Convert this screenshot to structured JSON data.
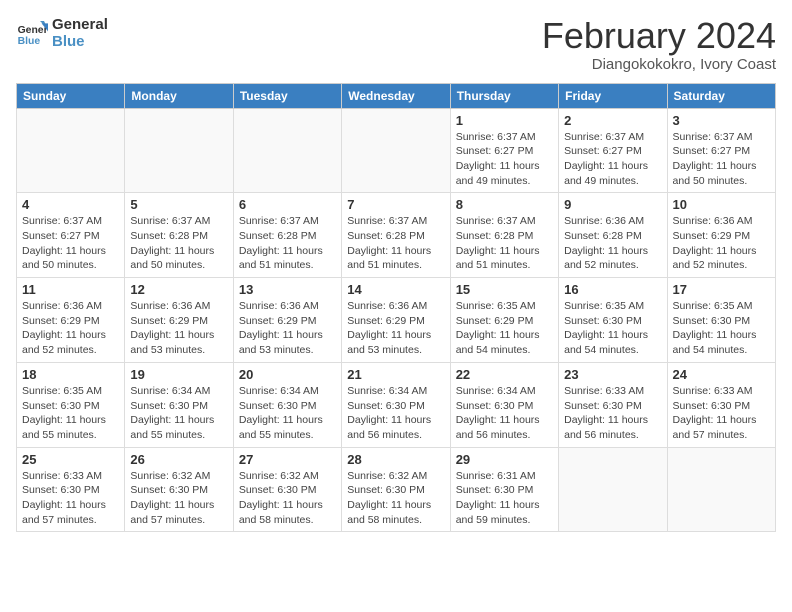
{
  "logo": {
    "line1": "General",
    "line2": "Blue"
  },
  "title": "February 2024",
  "subtitle": "Diangokokokro, Ivory Coast",
  "headers": [
    "Sunday",
    "Monday",
    "Tuesday",
    "Wednesday",
    "Thursday",
    "Friday",
    "Saturday"
  ],
  "weeks": [
    [
      {
        "day": "",
        "info": ""
      },
      {
        "day": "",
        "info": ""
      },
      {
        "day": "",
        "info": ""
      },
      {
        "day": "",
        "info": ""
      },
      {
        "day": "1",
        "info": "Sunrise: 6:37 AM\nSunset: 6:27 PM\nDaylight: 11 hours\nand 49 minutes."
      },
      {
        "day": "2",
        "info": "Sunrise: 6:37 AM\nSunset: 6:27 PM\nDaylight: 11 hours\nand 49 minutes."
      },
      {
        "day": "3",
        "info": "Sunrise: 6:37 AM\nSunset: 6:27 PM\nDaylight: 11 hours\nand 50 minutes."
      }
    ],
    [
      {
        "day": "4",
        "info": "Sunrise: 6:37 AM\nSunset: 6:27 PM\nDaylight: 11 hours\nand 50 minutes."
      },
      {
        "day": "5",
        "info": "Sunrise: 6:37 AM\nSunset: 6:28 PM\nDaylight: 11 hours\nand 50 minutes."
      },
      {
        "day": "6",
        "info": "Sunrise: 6:37 AM\nSunset: 6:28 PM\nDaylight: 11 hours\nand 51 minutes."
      },
      {
        "day": "7",
        "info": "Sunrise: 6:37 AM\nSunset: 6:28 PM\nDaylight: 11 hours\nand 51 minutes."
      },
      {
        "day": "8",
        "info": "Sunrise: 6:37 AM\nSunset: 6:28 PM\nDaylight: 11 hours\nand 51 minutes."
      },
      {
        "day": "9",
        "info": "Sunrise: 6:36 AM\nSunset: 6:28 PM\nDaylight: 11 hours\nand 52 minutes."
      },
      {
        "day": "10",
        "info": "Sunrise: 6:36 AM\nSunset: 6:29 PM\nDaylight: 11 hours\nand 52 minutes."
      }
    ],
    [
      {
        "day": "11",
        "info": "Sunrise: 6:36 AM\nSunset: 6:29 PM\nDaylight: 11 hours\nand 52 minutes."
      },
      {
        "day": "12",
        "info": "Sunrise: 6:36 AM\nSunset: 6:29 PM\nDaylight: 11 hours\nand 53 minutes."
      },
      {
        "day": "13",
        "info": "Sunrise: 6:36 AM\nSunset: 6:29 PM\nDaylight: 11 hours\nand 53 minutes."
      },
      {
        "day": "14",
        "info": "Sunrise: 6:36 AM\nSunset: 6:29 PM\nDaylight: 11 hours\nand 53 minutes."
      },
      {
        "day": "15",
        "info": "Sunrise: 6:35 AM\nSunset: 6:29 PM\nDaylight: 11 hours\nand 54 minutes."
      },
      {
        "day": "16",
        "info": "Sunrise: 6:35 AM\nSunset: 6:30 PM\nDaylight: 11 hours\nand 54 minutes."
      },
      {
        "day": "17",
        "info": "Sunrise: 6:35 AM\nSunset: 6:30 PM\nDaylight: 11 hours\nand 54 minutes."
      }
    ],
    [
      {
        "day": "18",
        "info": "Sunrise: 6:35 AM\nSunset: 6:30 PM\nDaylight: 11 hours\nand 55 minutes."
      },
      {
        "day": "19",
        "info": "Sunrise: 6:34 AM\nSunset: 6:30 PM\nDaylight: 11 hours\nand 55 minutes."
      },
      {
        "day": "20",
        "info": "Sunrise: 6:34 AM\nSunset: 6:30 PM\nDaylight: 11 hours\nand 55 minutes."
      },
      {
        "day": "21",
        "info": "Sunrise: 6:34 AM\nSunset: 6:30 PM\nDaylight: 11 hours\nand 56 minutes."
      },
      {
        "day": "22",
        "info": "Sunrise: 6:34 AM\nSunset: 6:30 PM\nDaylight: 11 hours\nand 56 minutes."
      },
      {
        "day": "23",
        "info": "Sunrise: 6:33 AM\nSunset: 6:30 PM\nDaylight: 11 hours\nand 56 minutes."
      },
      {
        "day": "24",
        "info": "Sunrise: 6:33 AM\nSunset: 6:30 PM\nDaylight: 11 hours\nand 57 minutes."
      }
    ],
    [
      {
        "day": "25",
        "info": "Sunrise: 6:33 AM\nSunset: 6:30 PM\nDaylight: 11 hours\nand 57 minutes."
      },
      {
        "day": "26",
        "info": "Sunrise: 6:32 AM\nSunset: 6:30 PM\nDaylight: 11 hours\nand 57 minutes."
      },
      {
        "day": "27",
        "info": "Sunrise: 6:32 AM\nSunset: 6:30 PM\nDaylight: 11 hours\nand 58 minutes."
      },
      {
        "day": "28",
        "info": "Sunrise: 6:32 AM\nSunset: 6:30 PM\nDaylight: 11 hours\nand 58 minutes."
      },
      {
        "day": "29",
        "info": "Sunrise: 6:31 AM\nSunset: 6:30 PM\nDaylight: 11 hours\nand 59 minutes."
      },
      {
        "day": "",
        "info": ""
      },
      {
        "day": "",
        "info": ""
      }
    ]
  ]
}
